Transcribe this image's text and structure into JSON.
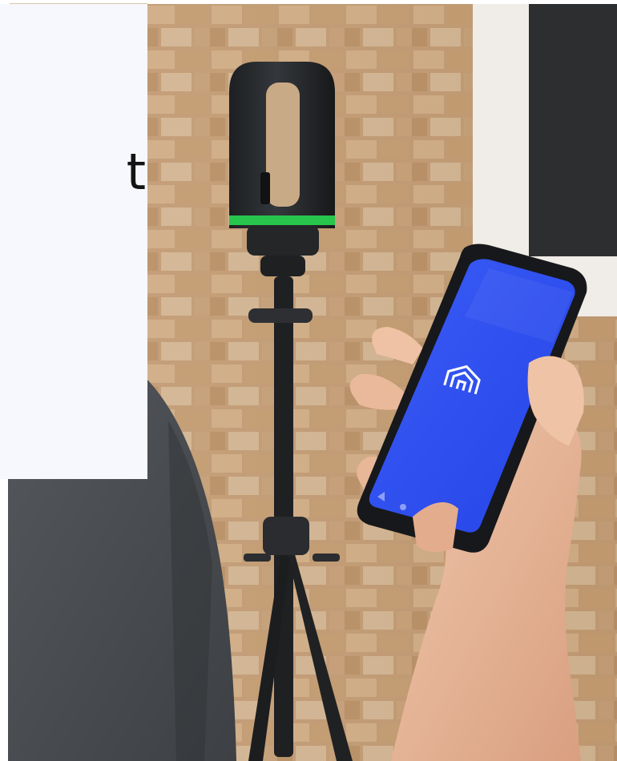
{
  "hero": {
    "text_card": {
      "heading_fragment": "t"
    },
    "image": {
      "subject": "reality-capture-scanner-on-tripod-with-phone-app",
      "phone_app_logo": "arch-logo-icon",
      "phone_nav_buttons": [
        "back-icon",
        "home-icon",
        "recent-icon"
      ],
      "ring_color": "#27c54b",
      "phone_screen_color": "#2f52f2"
    }
  }
}
